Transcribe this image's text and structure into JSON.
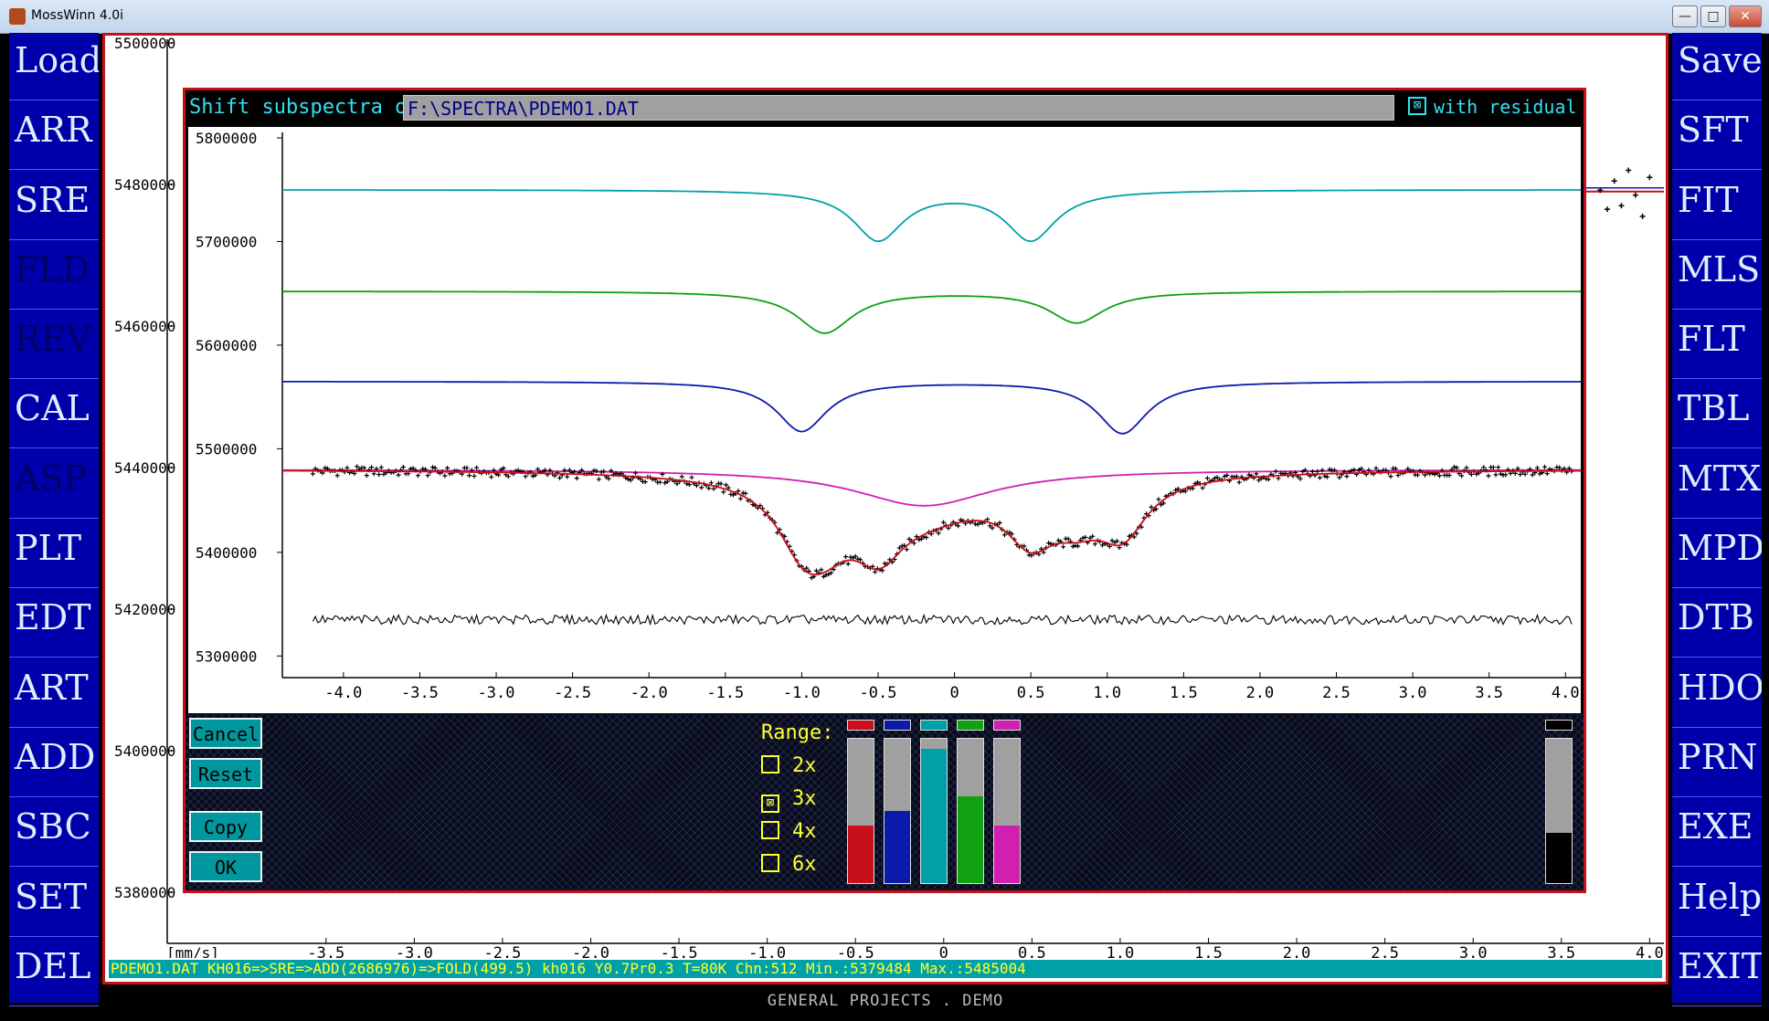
{
  "window": {
    "title": "MossWinn 4.0i",
    "minimize_label": "—",
    "maximize_label": "□",
    "close_label": "✕"
  },
  "left_menu": [
    {
      "label": "Load",
      "enabled": true
    },
    {
      "label": "ARR",
      "enabled": true
    },
    {
      "label": "SRE",
      "enabled": true
    },
    {
      "label": "FLD",
      "enabled": false
    },
    {
      "label": "REV",
      "enabled": false
    },
    {
      "label": "CAL",
      "enabled": true
    },
    {
      "label": "ASP",
      "enabled": false
    },
    {
      "label": "PLT",
      "enabled": true
    },
    {
      "label": "EDT",
      "enabled": true
    },
    {
      "label": "ART",
      "enabled": true
    },
    {
      "label": "ADD",
      "enabled": true
    },
    {
      "label": "SBC",
      "enabled": true
    },
    {
      "label": "SET",
      "enabled": true
    },
    {
      "label": "DEL",
      "enabled": true
    }
  ],
  "right_menu": [
    {
      "label": "Save",
      "enabled": true
    },
    {
      "label": "SFT",
      "enabled": true
    },
    {
      "label": "FIT",
      "enabled": true
    },
    {
      "label": "MLS",
      "enabled": true
    },
    {
      "label": "FLT",
      "enabled": true
    },
    {
      "label": "TBL",
      "enabled": true
    },
    {
      "label": "MTX",
      "enabled": true
    },
    {
      "label": "MPD",
      "enabled": true
    },
    {
      "label": "DTB",
      "enabled": true
    },
    {
      "label": "HDO",
      "enabled": true
    },
    {
      "label": "PRN",
      "enabled": true
    },
    {
      "label": "EXE",
      "enabled": true
    },
    {
      "label": "Help",
      "enabled": true
    },
    {
      "label": "EXIT",
      "enabled": true
    }
  ],
  "status_bar": "PDEMO1.DAT  KH016=>SRE=>ADD(2686976)=>FOLD(499.5)  kh016  Y0.7Pr0.3  T=80K  Chn:512  Min.:5379484  Max.:5485004",
  "footer": "GENERAL PROJECTS . DEMO",
  "dialog": {
    "title": "Shift subspectra of",
    "file": "F:\\SPECTRA\\PDEMO1.DAT",
    "with_residual_label": "with residual",
    "with_residual_mark": "⊠",
    "buttons": {
      "cancel": "Cancel",
      "reset": "Reset",
      "copy": "Copy",
      "ok": "OK"
    },
    "range": {
      "title": "Range:",
      "options": [
        {
          "label": "2x",
          "mark": ""
        },
        {
          "label": "3x",
          "mark": "⊠"
        },
        {
          "label": "4x",
          "mark": ""
        },
        {
          "label": "6x",
          "mark": ""
        }
      ],
      "selected": "3x"
    },
    "sliders": [
      {
        "color": "#c8101a",
        "level": 0.4
      },
      {
        "color": "#0a1aaa",
        "level": 0.5
      },
      {
        "color": "#00a0a8",
        "level": 0.93
      },
      {
        "color": "#10a010",
        "level": 0.6
      },
      {
        "color": "#d020b0",
        "level": 0.4
      }
    ],
    "residual_slider": {
      "color": "#000000",
      "level": 0.35
    }
  },
  "chart_data": [
    {
      "type": "line",
      "x_unit_label": "[mm/s]",
      "x_ticks": [
        "-3.5",
        "-3.0",
        "-2.5",
        "-2.0",
        "-1.5",
        "-1.0",
        "-0.5",
        "0",
        "0.5",
        "1.0",
        "1.5",
        "2.0",
        "2.5",
        "3.0",
        "3.5",
        "4.0"
      ],
      "y_ticks": [
        "5380000",
        "5400000",
        "5420000",
        "5440000",
        "5460000",
        "5480000",
        "5500000"
      ],
      "xlim": [
        -4.4,
        4.05
      ],
      "ylim": [
        5372000,
        5500000
      ],
      "visible_points_right": [
        {
          "x": 3.72,
          "y": 5479200
        },
        {
          "x": 3.76,
          "y": 5476500
        },
        {
          "x": 3.8,
          "y": 5480500
        },
        {
          "x": 3.84,
          "y": 5477000
        },
        {
          "x": 3.88,
          "y": 5482000
        },
        {
          "x": 3.92,
          "y": 5478500
        },
        {
          "x": 3.96,
          "y": 5475500
        },
        {
          "x": 4.0,
          "y": 5481000
        }
      ],
      "fit_level": 5479000
    },
    {
      "type": "line",
      "x_ticks": [
        "-4.0",
        "-3.5",
        "-3.0",
        "-2.5",
        "-2.0",
        "-1.5",
        "-1.0",
        "-0.5",
        "0",
        "0.5",
        "1.0",
        "1.5",
        "2.0",
        "2.5",
        "3.0",
        "3.5",
        "4.0"
      ],
      "y_ticks": [
        "5300000",
        "5400000",
        "5500000",
        "5600000",
        "5700000",
        "5800000"
      ],
      "xlim": [
        -4.4,
        4.1
      ],
      "ylim": [
        5280000,
        5800000
      ],
      "series": [
        {
          "color": "#00a0a8",
          "baseline": 5750000,
          "lines": [
            {
              "center": -0.5,
              "depth": 48000,
              "width": 0.2
            },
            {
              "center": 0.5,
              "depth": 48000,
              "width": 0.2
            }
          ]
        },
        {
          "color": "#10a010",
          "baseline": 5652000,
          "lines": [
            {
              "center": -0.85,
              "depth": 40000,
              "width": 0.22
            },
            {
              "center": 0.8,
              "depth": 30000,
              "width": 0.22
            }
          ]
        },
        {
          "color": "#0a1aaa",
          "baseline": 5565000,
          "lines": [
            {
              "center": -1.0,
              "depth": 48000,
              "width": 0.2
            },
            {
              "center": 1.1,
              "depth": 50000,
              "width": 0.2
            }
          ]
        },
        {
          "color": "#d020b0",
          "baseline": 5480000,
          "lines": [
            {
              "center": -0.2,
              "depth": 35000,
              "width": 0.55
            }
          ]
        }
      ],
      "data_baseline": 5480000,
      "residual_level": 5335000
    }
  ]
}
